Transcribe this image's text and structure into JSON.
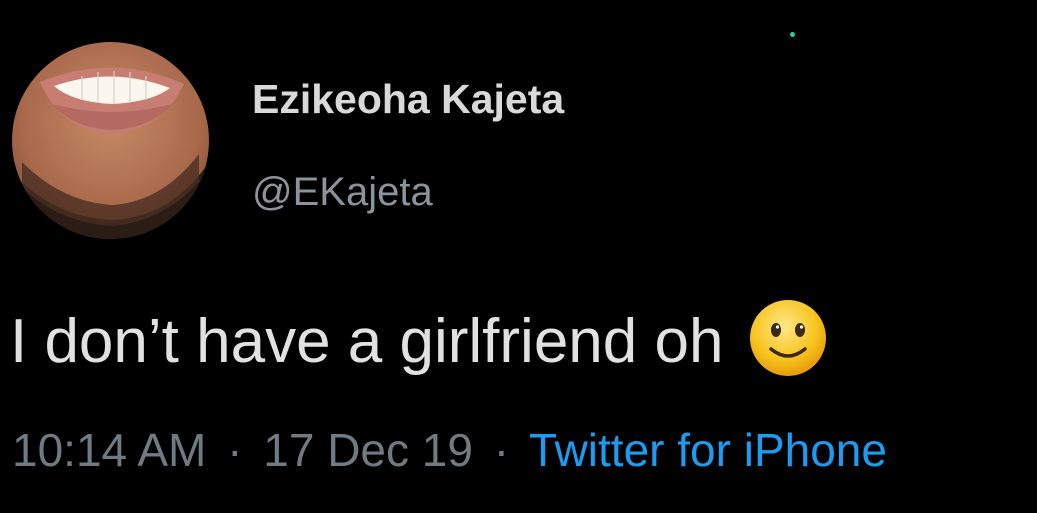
{
  "tweet": {
    "display_name": "Ezikeoha Kajeta",
    "handle": "@EKajeta",
    "text": "I don’t have a girlfriend oh",
    "emoji": "slightly-smiling-face-icon",
    "time": "10:14 AM",
    "separator": "·",
    "date": "17 Dec 19",
    "source": "Twitter for iPhone"
  },
  "colors": {
    "background": "#000000",
    "display_name": "#d9d9d9",
    "handle": "#8b949b",
    "text": "#e1e1e1",
    "meta": "#6f7a82",
    "link": "#1d9bf0",
    "emoji": "#f7c51e"
  }
}
